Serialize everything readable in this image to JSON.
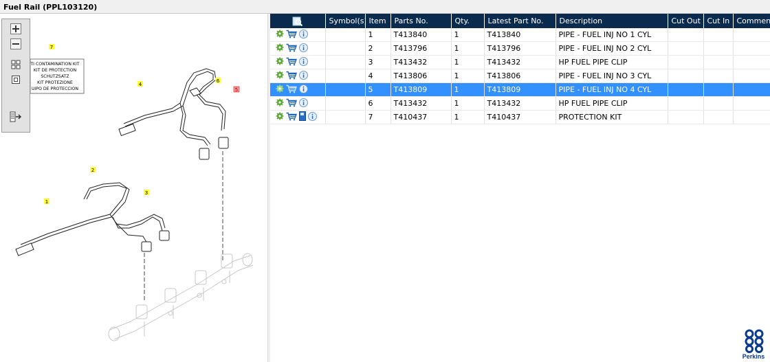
{
  "window": {
    "title": "Fuel Rail (PPL103120)"
  },
  "diagram": {
    "kit_label_lines": [
      "TI CONTAMINATION KIT",
      "KIT DE PROTECTION",
      "SCHUTZSATZ",
      "KIT PROTEZIONE",
      "UIPO DE PROTECCION"
    ],
    "callouts": [
      "7",
      "4",
      "6",
      "5",
      "2",
      "3",
      "1"
    ]
  },
  "table": {
    "columns": [
      "Symbol(s)",
      "Item",
      "Parts No.",
      "Qty.",
      "Latest Part No.",
      "Description",
      "Cut Out",
      "Cut In",
      "Comment"
    ],
    "rows": [
      {
        "item": "1",
        "part_no": "T413840",
        "qty": "1",
        "latest": "T413840",
        "description": "PIPE - FUEL INJ NO 1 CYL",
        "has_book": false
      },
      {
        "item": "2",
        "part_no": "T413796",
        "qty": "1",
        "latest": "T413796",
        "description": "PIPE - FUEL INJ NO 2 CYL",
        "has_book": false
      },
      {
        "item": "3",
        "part_no": "T413432",
        "qty": "1",
        "latest": "T413432",
        "description": "HP FUEL PIPE CLIP",
        "has_book": false
      },
      {
        "item": "4",
        "part_no": "T413806",
        "qty": "1",
        "latest": "T413806",
        "description": "PIPE - FUEL INJ NO 3 CYL",
        "has_book": false
      },
      {
        "item": "5",
        "part_no": "T413809",
        "qty": "1",
        "latest": "T413809",
        "description": "PIPE - FUEL INJ NO 4 CYL",
        "has_book": false,
        "selected": true
      },
      {
        "item": "6",
        "part_no": "T413432",
        "qty": "1",
        "latest": "T413432",
        "description": "HP FUEL PIPE CLIP",
        "has_book": false
      },
      {
        "item": "7",
        "part_no": "T410437",
        "qty": "1",
        "latest": "T410437",
        "description": "PROTECTION KIT",
        "has_book": true
      }
    ]
  },
  "brand": {
    "name": "Perkins",
    "color": "#0a3a8c"
  },
  "colors": {
    "header_bg": "#0a2b4e",
    "selected_row": "#3390ff",
    "callout_yellow": "#ffff33",
    "callout_red": "#ff9999"
  }
}
